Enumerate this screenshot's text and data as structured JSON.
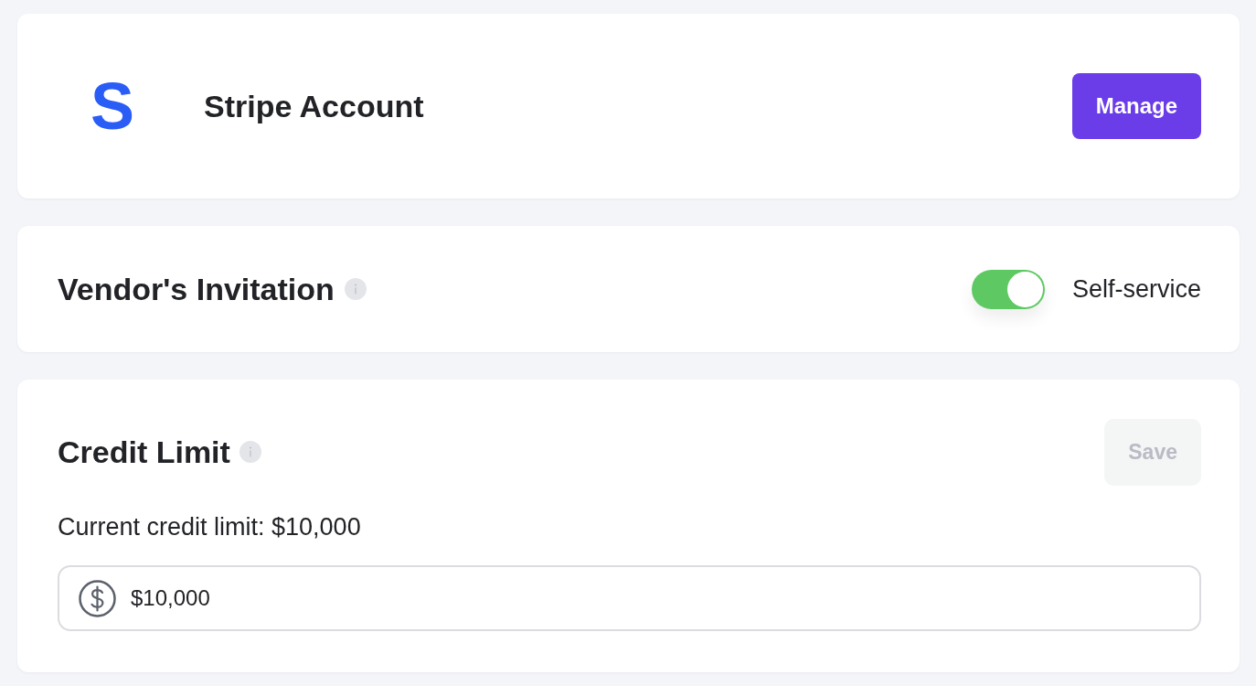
{
  "stripe_account": {
    "logo": "S",
    "title": "Stripe Account",
    "button": "Manage"
  },
  "vendors_invitation": {
    "title": "Vendor's Invitation",
    "toggle": {
      "on": true,
      "label": "Self-service"
    }
  },
  "credit_limit": {
    "title": "Credit Limit",
    "save_button": {
      "label": "Save",
      "disabled": true
    },
    "current_limit": "Current credit limit: $10,000",
    "input": {
      "value": "$10,000"
    }
  }
}
